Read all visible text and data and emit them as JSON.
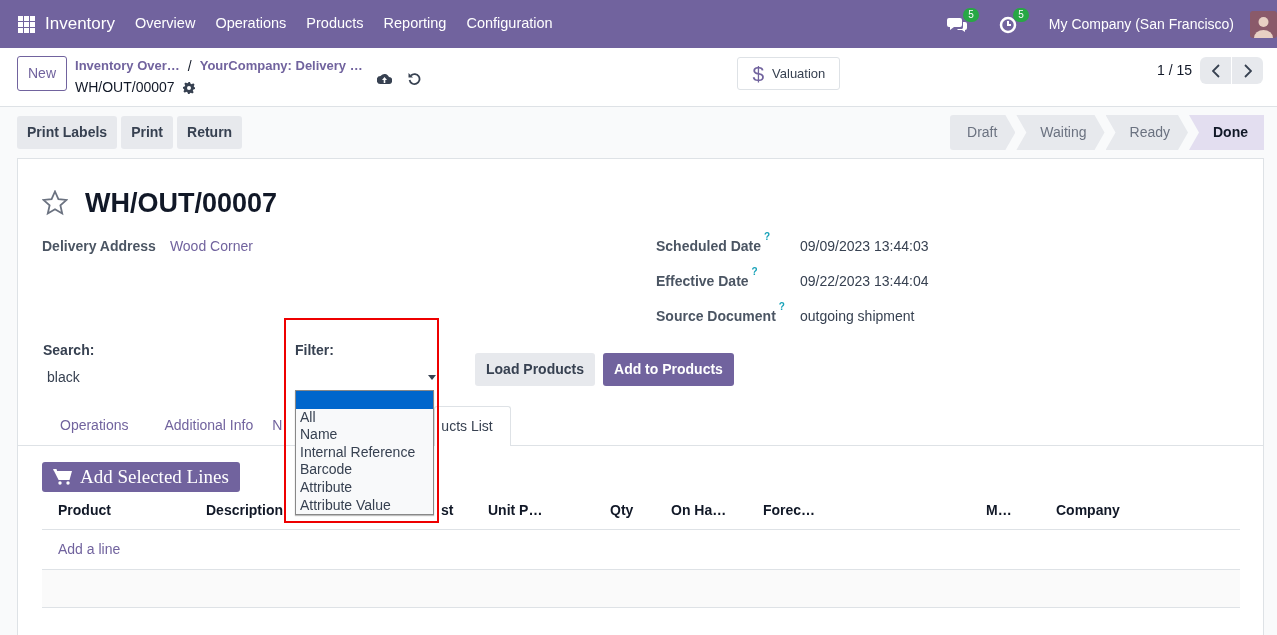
{
  "app_bar": {
    "app_name": "Inventory",
    "menu": [
      "Overview",
      "Operations",
      "Products",
      "Reporting",
      "Configuration"
    ],
    "messages_badge": "5",
    "activities_badge": "5",
    "company": "My Company (San Francisco)"
  },
  "control_panel": {
    "new_button": "New",
    "breadcrumbs": [
      "Inventory Over…",
      "YourCompany: Delivery …"
    ],
    "separator": "/",
    "record": "WH/OUT/00007",
    "valuation_button": {
      "icon": "$",
      "label": "Valuation"
    },
    "pager": "1 / 15"
  },
  "action_buttons": [
    "Print Labels",
    "Print",
    "Return"
  ],
  "status_steps": [
    {
      "label": "Draft",
      "selected": false
    },
    {
      "label": "Waiting",
      "selected": false
    },
    {
      "label": "Ready",
      "selected": false
    },
    {
      "label": "Done",
      "selected": true
    }
  ],
  "form": {
    "starred": false,
    "title": "WH/OUT/00007",
    "left_fields": [
      {
        "label": "Delivery Address",
        "value": "Wood Corner"
      }
    ],
    "right_fields": [
      {
        "label": "Scheduled Date",
        "help": "?",
        "value": "09/09/2023 13:44:03"
      },
      {
        "label": "Effective Date",
        "help": "?",
        "value": "09/22/2023 13:44:04"
      },
      {
        "label": "Source Document",
        "help": "?",
        "value": "outgoing shipment"
      }
    ]
  },
  "search": {
    "label": "Search:",
    "value": "black"
  },
  "filter": {
    "label": "Filter:",
    "highlighted": true,
    "blank_option_selected": true,
    "options": [
      {
        "label": "All",
        "selected": false
      },
      {
        "label": "Name",
        "selected": false
      },
      {
        "label": "Internal Reference",
        "selected": false
      },
      {
        "label": "Barcode",
        "selected": false
      },
      {
        "label": "Attribute",
        "selected": false
      },
      {
        "label": "Attribute Value",
        "selected": false
      }
    ]
  },
  "buttons": [
    {
      "label": "Load Products",
      "kind": "secondary"
    },
    {
      "label": "Add to Products",
      "kind": "primary"
    }
  ],
  "tabs": [
    {
      "label": "Operations",
      "selected": false
    },
    {
      "label": "Additional Info",
      "selected": false
    },
    {
      "label": "N",
      "selected": false
    },
    {
      "label": "ucts List",
      "selected": true
    }
  ],
  "add_selected_button": "Add Selected Lines",
  "table": {
    "columns": [
      "Product",
      "Description",
      "st",
      "Unit P…",
      "Qty",
      "On Ha…",
      "Forec…",
      "M…",
      "Company"
    ],
    "add_line": "Add a line"
  }
}
